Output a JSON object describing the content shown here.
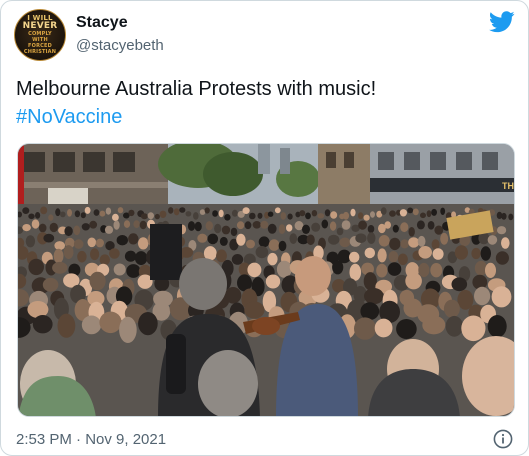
{
  "author": {
    "display_name": "Stacye",
    "handle": "@stacyebeth",
    "avatar_lines": [
      "I WILL",
      "NEVER",
      "COMPLY",
      "WITH",
      "FORCED",
      "CHRISTIAN"
    ]
  },
  "tweet": {
    "text": "Melbourne Australia Protests with music!",
    "hashtag": "#NoVaccine"
  },
  "media": {
    "shop_sign": "THE"
  },
  "footer": {
    "timestamp": "2:53 PM · Nov 9, 2021"
  },
  "icons": {
    "brand": "twitter-bird-icon",
    "info": "info-icon"
  },
  "colors": {
    "accent": "#1d9bf0",
    "secondary_text": "#536471",
    "border": "#cfd9de"
  }
}
